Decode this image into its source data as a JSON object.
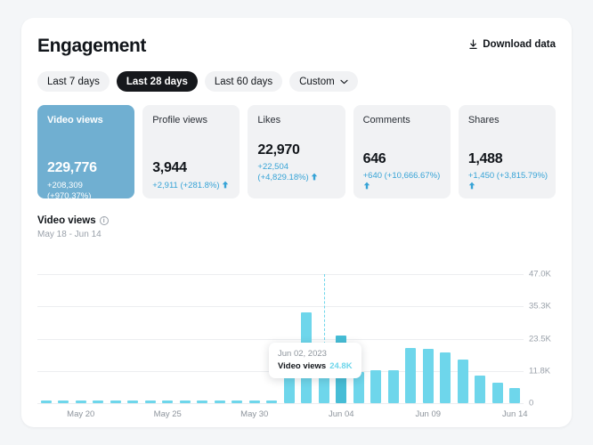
{
  "header": {
    "title": "Engagement",
    "download_label": "Download data",
    "download_icon": "download-icon"
  },
  "range_tabs": [
    {
      "label": "Last 7 days",
      "active": false,
      "has_chevron": false
    },
    {
      "label": "Last 28 days",
      "active": true,
      "has_chevron": false
    },
    {
      "label": "Last 60 days",
      "active": false,
      "has_chevron": false
    },
    {
      "label": "Custom",
      "active": false,
      "has_chevron": true
    }
  ],
  "metrics": [
    {
      "label": "Video views",
      "value": "229,776",
      "delta": "+208,309 (+970.37%)",
      "selected": true,
      "arrow": "arrow-up-icon",
      "arrow_inline": false
    },
    {
      "label": "Profile views",
      "value": "3,944",
      "delta": "+2,911 (+281.8%)",
      "selected": false,
      "arrow": "arrow-up-icon",
      "arrow_inline": true
    },
    {
      "label": "Likes",
      "value": "22,970",
      "delta": "+22,504 (+4,829.18%)",
      "selected": false,
      "arrow": "arrow-up-icon",
      "arrow_inline": false
    },
    {
      "label": "Comments",
      "value": "646",
      "delta": "+640 (+10,666.67%)",
      "selected": false,
      "arrow": "arrow-up-icon",
      "arrow_inline": false
    },
    {
      "label": "Shares",
      "value": "1,488",
      "delta": "+1,450 (+3,815.79%)",
      "selected": false,
      "arrow": "arrow-up-icon",
      "arrow_inline": false
    }
  ],
  "chart_section": {
    "title": "Video views",
    "info_icon": "info-icon",
    "subtitle": "May 18 - Jun 14"
  },
  "tooltip": {
    "date": "Jun 02, 2023",
    "series_label": "Video views",
    "value": "24.8K"
  },
  "colors": {
    "bar": "#6ED6EB",
    "bar_highlight": "#46BDD6",
    "accent_text": "#36a3d6",
    "selected_card": "#70AFD1",
    "chip_active": "#16181c"
  },
  "chart_data": {
    "type": "bar",
    "title": "Video views",
    "subtitle": "May 18 - Jun 14",
    "xlabel": "",
    "ylabel": "",
    "ylim": [
      0,
      47000
    ],
    "grid": true,
    "legend": false,
    "y_ticks": [
      {
        "value": 0,
        "label": "0"
      },
      {
        "value": 11750,
        "label": "11.8K"
      },
      {
        "value": 23500,
        "label": "23.5K"
      },
      {
        "value": 35250,
        "label": "35.3K"
      },
      {
        "value": 47000,
        "label": "47.0K"
      }
    ],
    "x_ticks": [
      {
        "index": 2,
        "label": "May 20"
      },
      {
        "index": 7,
        "label": "May 25"
      },
      {
        "index": 12,
        "label": "May 30"
      },
      {
        "index": 17,
        "label": "Jun 04"
      },
      {
        "index": 22,
        "label": "Jun 09"
      },
      {
        "index": 27,
        "label": "Jun 14"
      }
    ],
    "categories": [
      "May 18",
      "May 19",
      "May 20",
      "May 21",
      "May 22",
      "May 23",
      "May 24",
      "May 25",
      "May 26",
      "May 27",
      "May 28",
      "May 29",
      "May 30",
      "May 31",
      "Jun 01",
      "Jun 02",
      "Jun 03",
      "Jun 04",
      "Jun 05",
      "Jun 06",
      "Jun 07",
      "Jun 08",
      "Jun 09",
      "Jun 10",
      "Jun 11",
      "Jun 12",
      "Jun 13",
      "Jun 14"
    ],
    "values": [
      400,
      420,
      430,
      410,
      420,
      400,
      430,
      420,
      410,
      420,
      400,
      410,
      420,
      430,
      10800,
      33000,
      11300,
      24800,
      11500,
      11900,
      12000,
      20000,
      19800,
      18500,
      15800,
      10200,
      7600,
      5600
    ],
    "highlight_index": 17,
    "cursor_index": 16,
    "series_name": "Video views"
  }
}
